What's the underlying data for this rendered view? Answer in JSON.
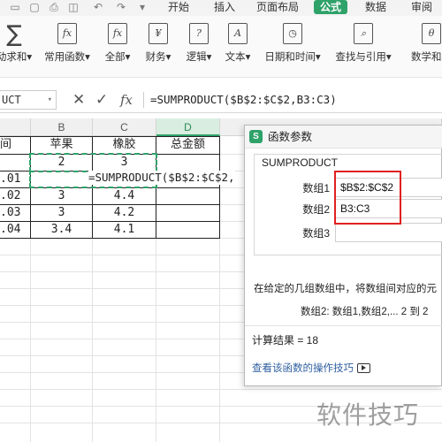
{
  "menu": {
    "tabs": [
      "开始",
      "插入",
      "页面布局",
      "公式",
      "数据",
      "审阅"
    ],
    "active_tab": "公式",
    "accent": "#2fa26a"
  },
  "ribbon": {
    "buttons": [
      {
        "label": "动求和▾",
        "icon": "sigma-icon"
      },
      {
        "label": "常用函数▾",
        "icon": "star-fx-icon"
      },
      {
        "label": "全部▾",
        "icon": "fx-book-icon"
      },
      {
        "label": "财务▾",
        "icon": "yen-book-icon"
      },
      {
        "label": "逻辑▾",
        "icon": "question-book-icon"
      },
      {
        "label": "文本▾",
        "icon": "a-book-icon"
      },
      {
        "label": "日期和时间▾",
        "icon": "clock-book-icon"
      },
      {
        "label": "查找与引用▾",
        "icon": "search-book-icon"
      },
      {
        "label": "数学和三",
        "icon": "theta-book-icon"
      }
    ]
  },
  "formula_bar": {
    "name_box": "UCT",
    "formula": "=SUMPRODUCT($B$2:$C$2,B3:C3)"
  },
  "grid": {
    "columns": [
      "B",
      "C",
      "D"
    ],
    "selected_column": "D",
    "rows": [
      [
        "间",
        "苹果",
        "橡胶",
        "总金额"
      ],
      [
        "",
        "2",
        "3",
        ""
      ],
      [
        ".01",
        "",
        "",
        ""
      ],
      [
        ".02",
        "3",
        "4.4",
        ""
      ],
      [
        ".03",
        "3",
        "4.2",
        ""
      ],
      [
        ".04",
        "3.4",
        "4.1",
        ""
      ]
    ],
    "inline_formula": "=SUMPRODUCT($B$2:$C$2,"
  },
  "dialog": {
    "title": "函数参数",
    "function_name": "SUMPRODUCT",
    "args": [
      {
        "label": "数组1",
        "value": "$B$2:$C$2"
      },
      {
        "label": "数组2",
        "value": "B3:C3"
      },
      {
        "label": "数组3",
        "value": ""
      }
    ],
    "description": "在给定的几组数组中，将数组间对应的元",
    "arg_help": "数组2:  数组1,数组2,... 2 到 2",
    "result": "计算结果 = 18",
    "help_link": "查看该函数的操作技巧"
  },
  "watermark": "软件技巧"
}
